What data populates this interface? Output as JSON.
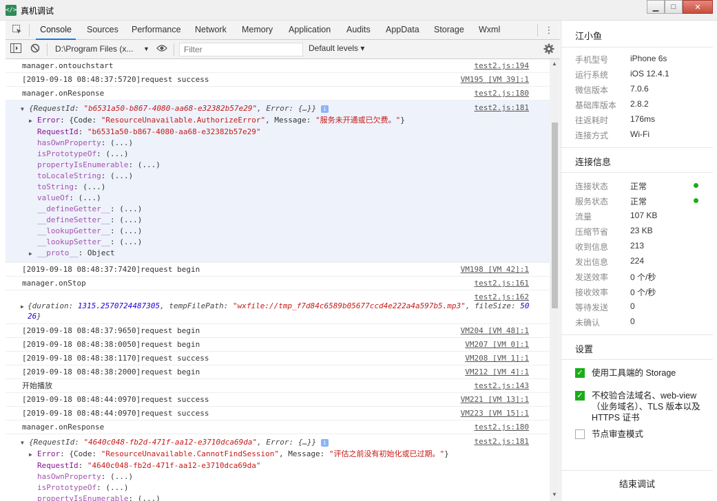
{
  "window": {
    "title": "真机调试",
    "min": "▁",
    "max": "□",
    "close": "✕"
  },
  "tabs": [
    "Console",
    "Sources",
    "Performance",
    "Network",
    "Memory",
    "Application",
    "Audits",
    "AppData",
    "Storage",
    "Wxml"
  ],
  "toolbar": {
    "context": "D:\\Program Files (x...",
    "filter_placeholder": "Filter",
    "levels": "Default levels ▾"
  },
  "console": {
    "r1": {
      "text": "manager.ontouchstart",
      "src": "test2.js:194"
    },
    "r2": {
      "text": "[2019-09-18 08:48:37:5720]request success",
      "src": "VM195 [VM 39]:1"
    },
    "r3": {
      "text": "manager.onResponse",
      "src": "test2.js:180"
    },
    "o1": {
      "src": "test2.js:181",
      "head_open": "{RequestId: ",
      "head_id": "\"b6531a50-b867-4080-aa68-e32382b57e29\"",
      "head_mid": ", Error: {…}}",
      "err_key": "Error",
      "err_pre": ": {Code: ",
      "err_code": "\"ResourceUnavailable.AuthorizeError\"",
      "err_mid": ", Message: ",
      "err_msg": "\"服务未开通或已欠费。\"",
      "err_end": "}",
      "rid_key": "RequestId",
      "rid_val": "\"b6531a50-b867-4080-aa68-e32382b57e29\"",
      "protos": [
        "hasOwnProperty",
        "isPrototypeOf",
        "propertyIsEnumerable",
        "toLocaleString",
        "toString",
        "valueOf",
        "__defineGetter__",
        "__defineSetter__",
        "__lookupGetter__",
        "__lookupSetter__"
      ],
      "fn_val": ": (...)",
      "proto_key": "__proto__",
      "proto_val": ": Object"
    },
    "r4": {
      "text": "[2019-09-18 08:48:37:7420]request begin",
      "src": "VM198 [VM 42]:1"
    },
    "r5": {
      "text": "manager.onStop",
      "src": "test2.js:161"
    },
    "r6": {
      "src": "test2.js:162",
      "a": "{duration: ",
      "dur": "1315.2570724487305",
      "b": ", tempFilePath: ",
      "path": "\"wxfile://tmp_f7d84c6589b05677ccd4e222a4a597b5.mp3\"",
      "c": ", fileSize: ",
      "size1": "50",
      "size2": "26",
      "d": "}"
    },
    "r7": {
      "text": "[2019-09-18 08:48:37:9650]request begin",
      "src": "VM204 [VM 48]:1"
    },
    "r8": {
      "text": "[2019-09-18 08:48:38:0050]request begin",
      "src": "VM207 [VM 0]:1"
    },
    "r9": {
      "text": "[2019-09-18 08:48:38:1170]request success",
      "src": "VM208 [VM 1]:1"
    },
    "r10": {
      "text": "[2019-09-18 08:48:38:2000]request begin",
      "src": "VM212 [VM 4]:1"
    },
    "r11": {
      "text": "开始播放",
      "src": "test2.js:143"
    },
    "r12": {
      "text": "[2019-09-18 08:48:44:0970]request success",
      "src": "VM221 [VM 13]:1"
    },
    "r13": {
      "text": "[2019-09-18 08:48:44:0970]request success",
      "src": "VM223 [VM 15]:1"
    },
    "r14": {
      "text": "manager.onResponse",
      "src": "test2.js:180"
    },
    "o2": {
      "src": "test2.js:181",
      "head_open": "{RequestId: ",
      "head_id": "\"4640c048-fb2d-471f-aa12-e3710dca69da\"",
      "head_mid": ", Error: {…}}",
      "err_key": "Error",
      "err_pre": ": {Code: ",
      "err_code": "\"ResourceUnavailable.CannotFindSession\"",
      "err_mid": ", Message: ",
      "err_msg": "\"评估之前没有初始化或已过期。\"",
      "err_end": "}",
      "rid_key": "RequestId",
      "rid_val": "\"4640c048-fb2d-471f-aa12-e3710dca69da\"",
      "protos": [
        "hasOwnProperty",
        "isPrototypeOf",
        "propertyIsEnumerable"
      ],
      "fn_val": ": (...)"
    }
  },
  "panel": {
    "name": "江小鱼",
    "device": [
      {
        "k": "手机型号",
        "v": "iPhone 6s"
      },
      {
        "k": "运行系统",
        "v": "iOS 12.4.1"
      },
      {
        "k": "微信版本",
        "v": "7.0.6"
      },
      {
        "k": "基础库版本",
        "v": "2.8.2"
      },
      {
        "k": "往返耗时",
        "v": "176ms"
      },
      {
        "k": "连接方式",
        "v": "Wi-Fi"
      }
    ],
    "conn_title": "连接信息",
    "conn": [
      {
        "k": "连接状态",
        "v": "正常"
      },
      {
        "k": "服务状态",
        "v": "正常"
      },
      {
        "k": "流量",
        "v": "107 KB"
      },
      {
        "k": "压缩节省",
        "v": "23 KB"
      },
      {
        "k": "收到信息",
        "v": "213"
      },
      {
        "k": "发出信息",
        "v": "224"
      },
      {
        "k": "发送效率",
        "v": "0 个/秒"
      },
      {
        "k": "接收效率",
        "v": "0 个/秒"
      },
      {
        "k": "等待发送",
        "v": "0"
      },
      {
        "k": "未确认",
        "v": "0"
      }
    ],
    "status_color": "#1aad19",
    "settings_title": "设置",
    "settings": [
      {
        "label": "使用工具端的 Storage",
        "checked": true
      },
      {
        "label": "不校验合法域名、web-view（业务域名）、TLS 版本以及 HTTPS 证书",
        "checked": true
      },
      {
        "label": "节点审查模式",
        "checked": false
      }
    ],
    "end_button": "结束调试"
  }
}
